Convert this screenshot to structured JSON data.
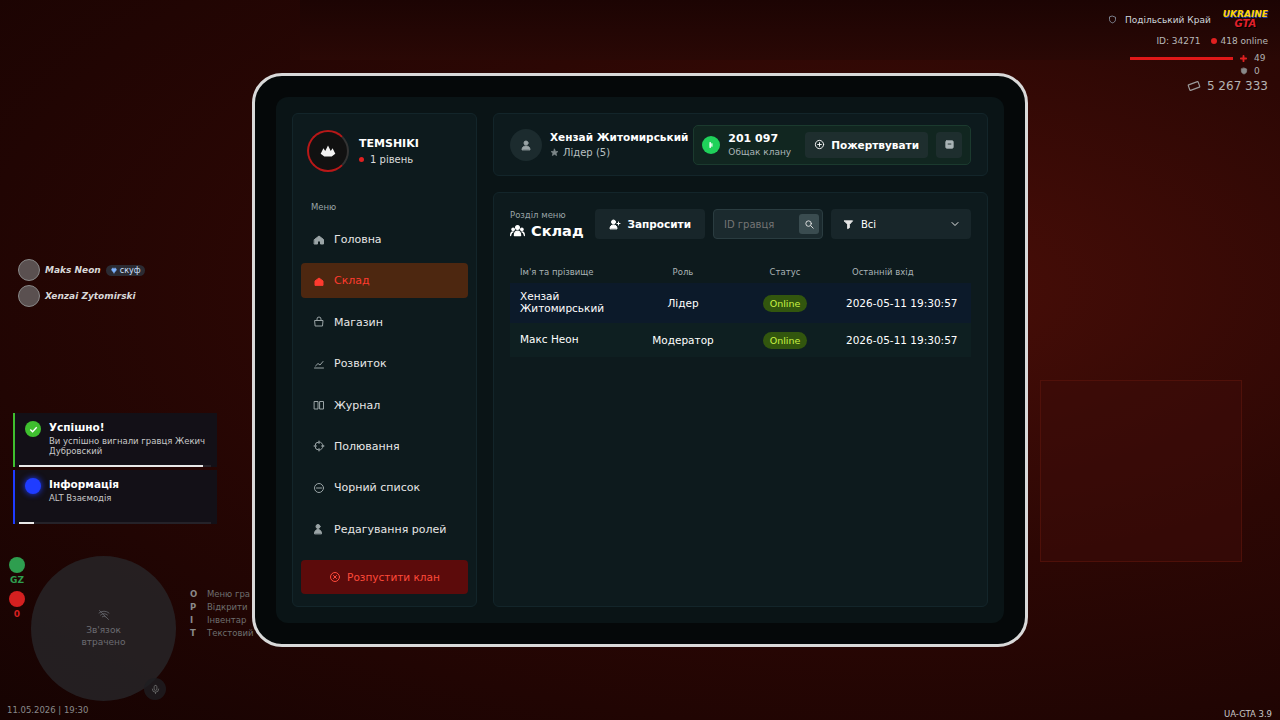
{
  "hud": {
    "region": "Подільський Край",
    "logo": [
      "UKRAINE",
      "GTA"
    ],
    "player_id": "ID: 34271",
    "online": "418 online",
    "health": {
      "value": "49",
      "level": 1
    },
    "armor": "0",
    "money": "5 267 333"
  },
  "nametags": [
    {
      "name": "Maks Neon",
      "badge": "скуф"
    },
    {
      "name": "Xenzai Zytomirski"
    }
  ],
  "notifications": [
    {
      "title": "Успішно!",
      "text": "Ви успішно вигнали гравця Жекич Дубровский",
      "kind": "success",
      "color": "#3fbf2f",
      "level": 0.96
    },
    {
      "title": "Інформація",
      "text": "ALT Взаємодія",
      "kind": "info",
      "color": "#1f3cff",
      "level": 0.08
    }
  ],
  "status_icons": [
    {
      "label": "GZ",
      "color": "#2e9e4f"
    },
    {
      "label": "0",
      "color": "#d42020"
    }
  ],
  "minimap": {
    "text": "Зв'язок втрачено"
  },
  "keys": [
    {
      "key": "O",
      "label": "Меню гра"
    },
    {
      "key": "P",
      "label": "Відкрити"
    },
    {
      "key": "I",
      "label": "Інвентар"
    },
    {
      "key": "T",
      "label": "Текстовий чат"
    }
  ],
  "datetime": "11.05.2026 | 19:30",
  "version": "UA-GTA 3.9",
  "tablet": {
    "clan": {
      "name": "TEMSHIKI",
      "level": "1 рівень"
    },
    "menu_title": "Меню",
    "sidebar": {
      "items": [
        {
          "label": "Головна",
          "selected": false
        },
        {
          "label": "Склад",
          "selected": true
        },
        {
          "label": "Магазин",
          "selected": false
        },
        {
          "label": "Розвиток",
          "selected": false
        },
        {
          "label": "Журнал",
          "selected": false
        },
        {
          "label": "Полювання",
          "selected": false
        },
        {
          "label": "Чорний список",
          "selected": false
        },
        {
          "label": "Редагування ролей",
          "selected": false
        }
      ]
    },
    "disband_button": "Розпустити клан",
    "user": {
      "name": "Хензай Житомирський",
      "role": "Лідер (5)"
    },
    "treasury": {
      "amount": "201 097",
      "label": "Общак клану"
    },
    "donate_button": "Пожертвувати",
    "section": {
      "caption": "Розділ меню",
      "title": "Склад"
    },
    "invite_button": "Запросити",
    "search": {
      "placeholder": "ID гравця"
    },
    "filter": {
      "value": "Всі"
    },
    "table": {
      "columns": [
        "Ім'я та прізвище",
        "Роль",
        "Статус",
        "Останній вхід"
      ],
      "rows": [
        {
          "name": "Хензай Житомирський",
          "role": "Лідер",
          "status": "Online",
          "last_login": "2026-05-11 19:30:57"
        },
        {
          "name": "Макс Неон",
          "role": "Модератор",
          "status": "Online",
          "last_login": "2026-05-11 19:30:57"
        }
      ]
    }
  }
}
